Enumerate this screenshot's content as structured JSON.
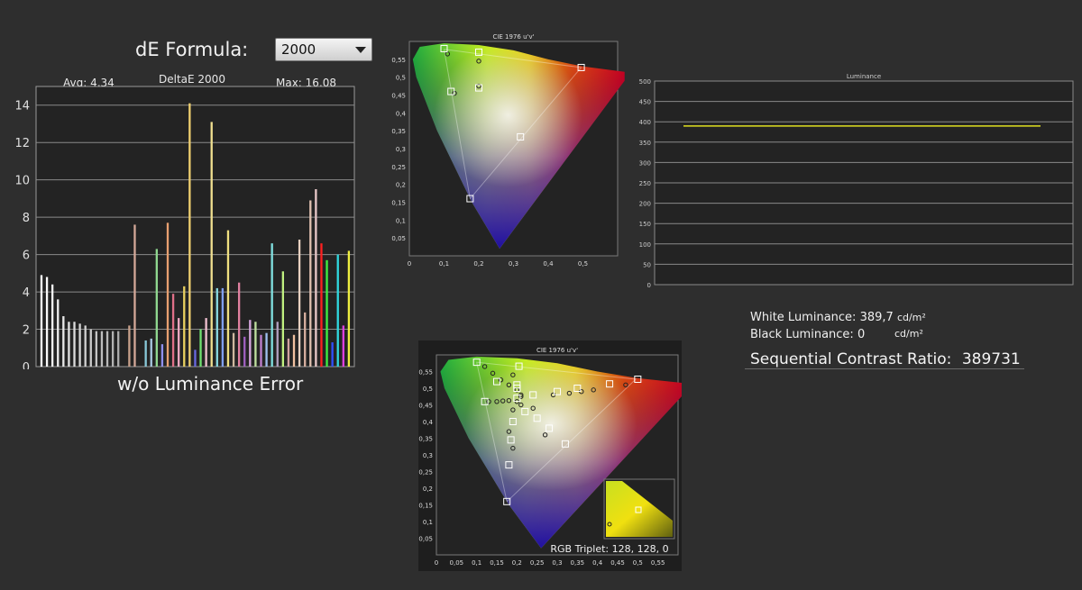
{
  "formula": {
    "label": "dE Formula:",
    "value": "2000"
  },
  "de_chart": {
    "avg": "Avg: 4,34",
    "title": "DeltaE 2000",
    "max": "Max: 16,08",
    "caption": "w/o Luminance Error"
  },
  "chart_data": [
    {
      "type": "bar",
      "title": "DeltaE 2000",
      "ylim": [
        0,
        15
      ],
      "yticks": [
        0,
        2,
        4,
        6,
        8,
        10,
        12,
        14
      ],
      "values": [
        4.9,
        4.8,
        4.4,
        3.6,
        2.7,
        2.4,
        2.4,
        2.3,
        2.2,
        2.0,
        1.9,
        1.9,
        1.9,
        1.9,
        1.9,
        0,
        2.2,
        7.6,
        0,
        1.4,
        1.5,
        6.3,
        1.2,
        7.7,
        3.9,
        2.6,
        4.3,
        14.1,
        0.9,
        2.0,
        2.6,
        13.1,
        4.2,
        4.2,
        7.3,
        1.8,
        4.5,
        1.6,
        2.5,
        2.4,
        1.7,
        1.8,
        6.6,
        2.4,
        5.1,
        1.5,
        1.7,
        6.8,
        2.9,
        8.9,
        9.5,
        6.6,
        5.7,
        1.3,
        6.0,
        2.2,
        6.2
      ],
      "colors": [
        "#ffffff",
        "#fafafa",
        "#f4f4f4",
        "#eeeeee",
        "#e8e8e8",
        "#e2e2e2",
        "#dcdcdc",
        "#d6d6d6",
        "#d0d0d0",
        "#cacaca",
        "#c4c4c4",
        "#bebebe",
        "#b8b8b8",
        "#b2b2b2",
        "#acacac",
        "#a6a6a6",
        "#c8a08a",
        "#d4a898",
        "#c0a0a0",
        "#88c8d8",
        "#a8c8e0",
        "#90d890",
        "#9090f0",
        "#e8a070",
        "#e07088",
        "#f0a8c0",
        "#e8d060",
        "#f0d070",
        "#6868e0",
        "#70e070",
        "#f0c0d0",
        "#f0e090",
        "#88d8e0",
        "#80a0f0",
        "#f0e080",
        "#d0b8a0",
        "#e080a0",
        "#a060c0",
        "#d8a8e0",
        "#c0e0a0",
        "#c080d0",
        "#a0c0f0",
        "#80e0e0",
        "#b0a0c0",
        "#c0f080",
        "#d0a0a0",
        "#f0c0a0",
        "#e8d0c0",
        "#d8b0a0",
        "#e0c0b0",
        "#e8c8c8",
        "#ff2020",
        "#40f040",
        "#3050ff",
        "#30d8e0",
        "#e040e0",
        "#f0f040"
      ]
    },
    {
      "type": "scatter",
      "title": "CIE 1976 u'v'",
      "xlim": [
        0,
        0.6
      ],
      "ylim": [
        0,
        0.6
      ],
      "xticks": [
        "0",
        "0,1",
        "0,2",
        "0,3",
        "0,4",
        "0,5"
      ],
      "yticks": [
        "0,05",
        "0,1",
        "0,15",
        "0,2",
        "0,25",
        "0,3",
        "0,35",
        "0,4",
        "0,45",
        "0,5",
        "0,55"
      ],
      "targets": [
        [
          0.1,
          0.58
        ],
        [
          0.2,
          0.57
        ],
        [
          0.495,
          0.527
        ],
        [
          0.12,
          0.46
        ],
        [
          0.2,
          0.47
        ],
        [
          0.32,
          0.333
        ],
        [
          0.175,
          0.16
        ]
      ],
      "measured": [
        [
          0.11,
          0.565
        ],
        [
          0.2,
          0.545
        ],
        [
          0.13,
          0.455
        ],
        [
          0.2,
          0.475
        ]
      ]
    },
    {
      "type": "line",
      "title": "Luminance",
      "ylim": [
        0,
        500
      ],
      "yticks": [
        "0",
        "50",
        "100",
        "150",
        "200",
        "250",
        "300",
        "350",
        "400",
        "450",
        "500"
      ],
      "series": [
        {
          "values": [
            389.7,
            389.7
          ]
        }
      ],
      "line_color": "#e0e020"
    },
    {
      "type": "scatter",
      "title": "CIE 1976 u'v'",
      "xlim": [
        0,
        0.6
      ],
      "ylim": [
        0,
        0.6
      ],
      "xticks": [
        "0",
        "0,05",
        "0,1",
        "0,15",
        "0,2",
        "0,25",
        "0,3",
        "0,35",
        "0,4",
        "0,45",
        "0,5",
        "0,55"
      ],
      "yticks": [
        "0,05",
        "0,1",
        "0,15",
        "0,2",
        "0,25",
        "0,3",
        "0,35",
        "0,4",
        "0,45",
        "0,5",
        "0,55"
      ],
      "targets": [
        [
          0.1,
          0.578
        ],
        [
          0.205,
          0.566
        ],
        [
          0.5,
          0.527
        ],
        [
          0.12,
          0.46
        ],
        [
          0.2,
          0.47
        ],
        [
          0.32,
          0.333
        ],
        [
          0.175,
          0.16
        ],
        [
          0.18,
          0.27
        ],
        [
          0.185,
          0.345
        ],
        [
          0.19,
          0.4
        ],
        [
          0.25,
          0.41
        ],
        [
          0.24,
          0.48
        ],
        [
          0.28,
          0.38
        ],
        [
          0.3,
          0.49
        ],
        [
          0.35,
          0.5
        ],
        [
          0.43,
          0.513
        ],
        [
          0.2,
          0.5
        ],
        [
          0.15,
          0.52
        ],
        [
          0.22,
          0.43
        ],
        [
          0.2,
          0.51
        ]
      ],
      "measured": [
        [
          0.12,
          0.565
        ],
        [
          0.14,
          0.545
        ],
        [
          0.16,
          0.525
        ],
        [
          0.18,
          0.51
        ],
        [
          0.2,
          0.495
        ],
        [
          0.2,
          0.46
        ],
        [
          0.21,
          0.475
        ],
        [
          0.19,
          0.435
        ],
        [
          0.15,
          0.46
        ],
        [
          0.13,
          0.46
        ],
        [
          0.165,
          0.462
        ],
        [
          0.18,
          0.463
        ],
        [
          0.21,
          0.45
        ],
        [
          0.24,
          0.44
        ],
        [
          0.27,
          0.36
        ],
        [
          0.18,
          0.37
        ],
        [
          0.19,
          0.32
        ],
        [
          0.29,
          0.48
        ],
        [
          0.33,
          0.485
        ],
        [
          0.36,
          0.49
        ],
        [
          0.39,
          0.495
        ],
        [
          0.47,
          0.51
        ],
        [
          0.21,
          0.48
        ],
        [
          0.19,
          0.54
        ]
      ],
      "inset_label": "RGB Triplet: 128, 128, 0"
    }
  ],
  "luminance": {
    "white_label": "White Luminance:",
    "white_value": "389,7",
    "white_unit": "cd/m²",
    "black_label": "Black Luminance:",
    "black_value": "0",
    "black_unit": "cd/m²"
  },
  "contrast": {
    "label": "Sequential Contrast Ratio:",
    "value": "389731"
  },
  "colors": {
    "background": "#2e2e2e",
    "plot_bg": "#232323",
    "gridline": "#8a8a8a",
    "lum_line": "#e0e020"
  }
}
